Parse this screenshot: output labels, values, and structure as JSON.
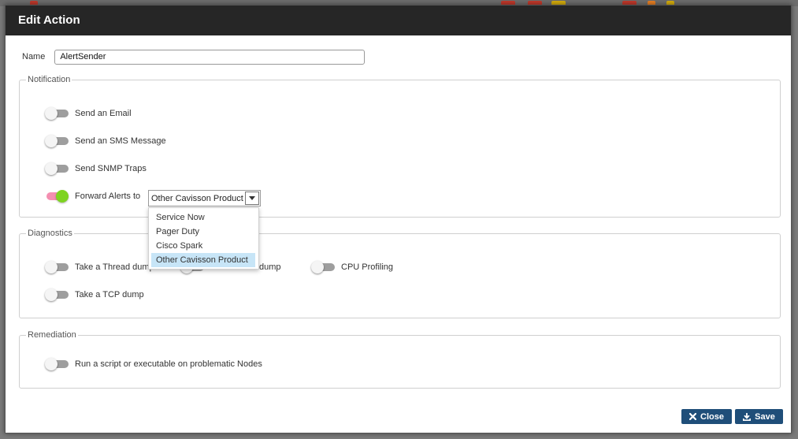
{
  "dialog": {
    "title": "Edit Action",
    "name_label": "Name",
    "name_value": "AlertSender"
  },
  "notification": {
    "legend": "Notification",
    "email_label": "Send an Email",
    "sms_label": "Send an SMS Message",
    "snmp_label": "Send SNMP Traps",
    "forward_label": "Forward Alerts to",
    "forward_selected": "Other Cavisson Product",
    "forward_options": [
      "Service Now",
      "Pager Duty",
      "Cisco Spark",
      "Other Cavisson Product"
    ],
    "toggles": {
      "email": false,
      "sms": false,
      "snmp": false,
      "forward": true
    }
  },
  "diagnostics": {
    "legend": "Diagnostics",
    "thread_dump_label": "Take a Thread dump",
    "heap_dump_label_visible": "dump",
    "cpu_profiling_label": "CPU Profiling",
    "tcp_dump_label": "Take a TCP dump"
  },
  "remediation": {
    "legend": "Remediation",
    "script_label": "Run a script or executable on problematic Nodes"
  },
  "buttons": {
    "close_label": "Close",
    "save_label": "Save"
  },
  "icons": {
    "close": "x-icon",
    "save": "download-icon",
    "select": "caret-down-icon"
  },
  "colors": {
    "titlebar": "#262626",
    "primary_button": "#1f4e79",
    "toggle_on_track": "#f48fb1",
    "toggle_on_knob": "#7ed321",
    "selected_option": "#c7e5f7"
  }
}
